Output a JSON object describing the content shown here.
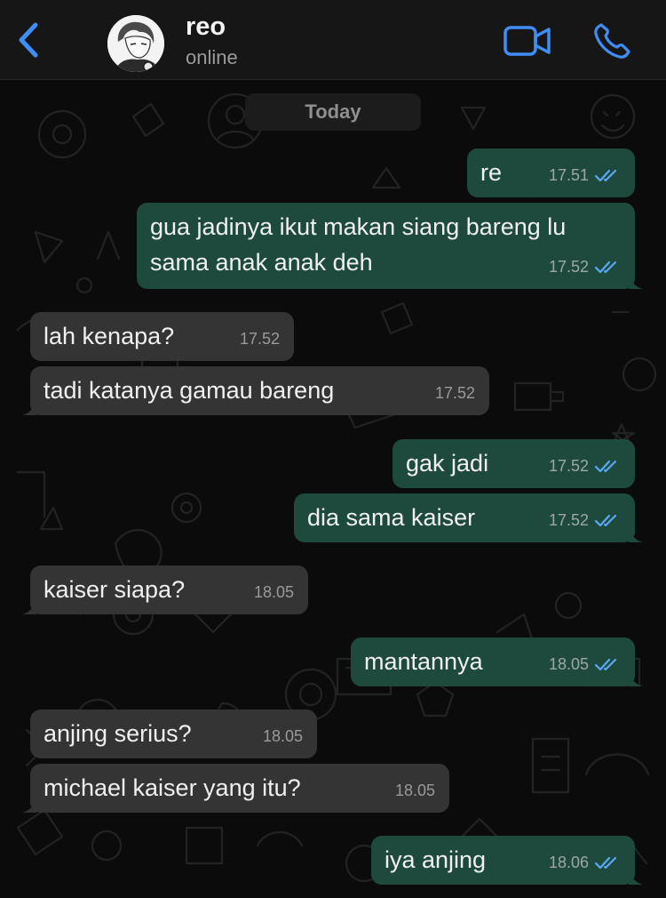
{
  "contact": {
    "name": "reo",
    "status": "online"
  },
  "date_separator": "Today",
  "messages": [
    {
      "dir": "out",
      "text": "re",
      "time": "17.51",
      "read": true
    },
    {
      "dir": "out",
      "text": "gua jadinya ikut makan siang bareng lu sama anak anak deh",
      "time": "17.52",
      "read": true
    },
    {
      "dir": "in",
      "text": "lah kenapa?",
      "time": "17.52"
    },
    {
      "dir": "in",
      "text": "tadi katanya gamau bareng",
      "time": "17.52"
    },
    {
      "dir": "out",
      "text": "gak jadi",
      "time": "17.52",
      "read": true
    },
    {
      "dir": "out",
      "text": "dia sama kaiser",
      "time": "17.52",
      "read": true
    },
    {
      "dir": "in",
      "text": "kaiser siapa?",
      "time": "18.05"
    },
    {
      "dir": "out",
      "text": "mantannya",
      "time": "18.05",
      "read": true
    },
    {
      "dir": "in",
      "text": "anjing serius?",
      "time": "18.05"
    },
    {
      "dir": "in",
      "text": "michael kaiser yang itu?",
      "time": "18.05"
    },
    {
      "dir": "out",
      "text": "iya anjing",
      "time": "18.06",
      "read": true
    }
  ],
  "colors": {
    "accent": "#3f8ef5",
    "outgoing_bubble": "#1e4a3d",
    "incoming_bubble": "#343434",
    "read_ticks": "#5aa9f2"
  },
  "icons": {
    "back": "chevron-left-icon",
    "video": "video-camera-icon",
    "call": "phone-icon",
    "read": "double-check-icon"
  }
}
